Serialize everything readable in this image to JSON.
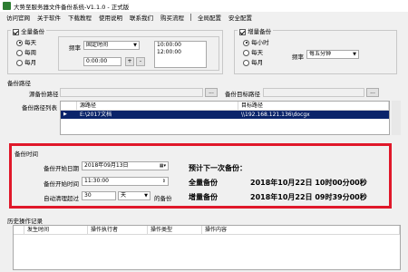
{
  "window": {
    "title": "大势至服务器文件备份系统-V1.1.0 - 正式版"
  },
  "menu": {
    "items": [
      "访问官网",
      "关于软件",
      "下载教程",
      "使用说明",
      "联系我们",
      "购买流程"
    ],
    "items_right": [
      "全局配置",
      "安全配置"
    ]
  },
  "full_backup": {
    "label": "全量备份",
    "checked": true,
    "options": [
      "每天",
      "每周",
      "每月"
    ],
    "selected": "每天",
    "frequency_label": "频率",
    "frequency_value": "固定时间",
    "time_value": "0:00:00",
    "time_list": [
      "10:00:00",
      "12:00:00"
    ],
    "add_button": "+",
    "remove_button": "-"
  },
  "incremental_backup": {
    "label": "增量备份",
    "checked": true,
    "options": [
      "每小时",
      "每天",
      "每月"
    ],
    "selected": "每小时",
    "frequency_label": "频率",
    "frequency_value": "每五分钟"
  },
  "backup_path": {
    "section_label": "备份路径",
    "source_label": "源备份路径",
    "source_value": "",
    "source_browse": "...",
    "target_label": "备份目标路径",
    "target_value": "",
    "target_browse": "...",
    "list_label": "备份路径列表",
    "columns": [
      "源路径",
      "目标路径"
    ],
    "rows": [
      {
        "source": "E:\\2017文档",
        "target": "\\\\192.168.121.136\\docgx"
      }
    ]
  },
  "backup_time": {
    "section_label": "备份时间",
    "start_date_label": "备份开始日期",
    "start_date_value": "2018年09月13日",
    "start_time_label": "备份开始时间",
    "start_time_value": "11:30:00",
    "auto_clean_label": "自动清理超过",
    "auto_clean_value": "30",
    "auto_clean_unit": "天",
    "auto_clean_suffix": "的备份",
    "next_label": "预计下一次备份：",
    "full_next_label": "全量备份",
    "full_next_value": "2018年10月22日  10时00分00秒",
    "incr_next_label": "增量备份",
    "incr_next_value": "2018年10月22日  09时39分00秒"
  },
  "history": {
    "section_label": "历史操作记录",
    "columns": [
      "发生时间",
      "操作执行者",
      "操作类型",
      "操作内容"
    ]
  },
  "colors": {
    "highlight_frame": "#e0182a",
    "selection": "#0a246a"
  }
}
